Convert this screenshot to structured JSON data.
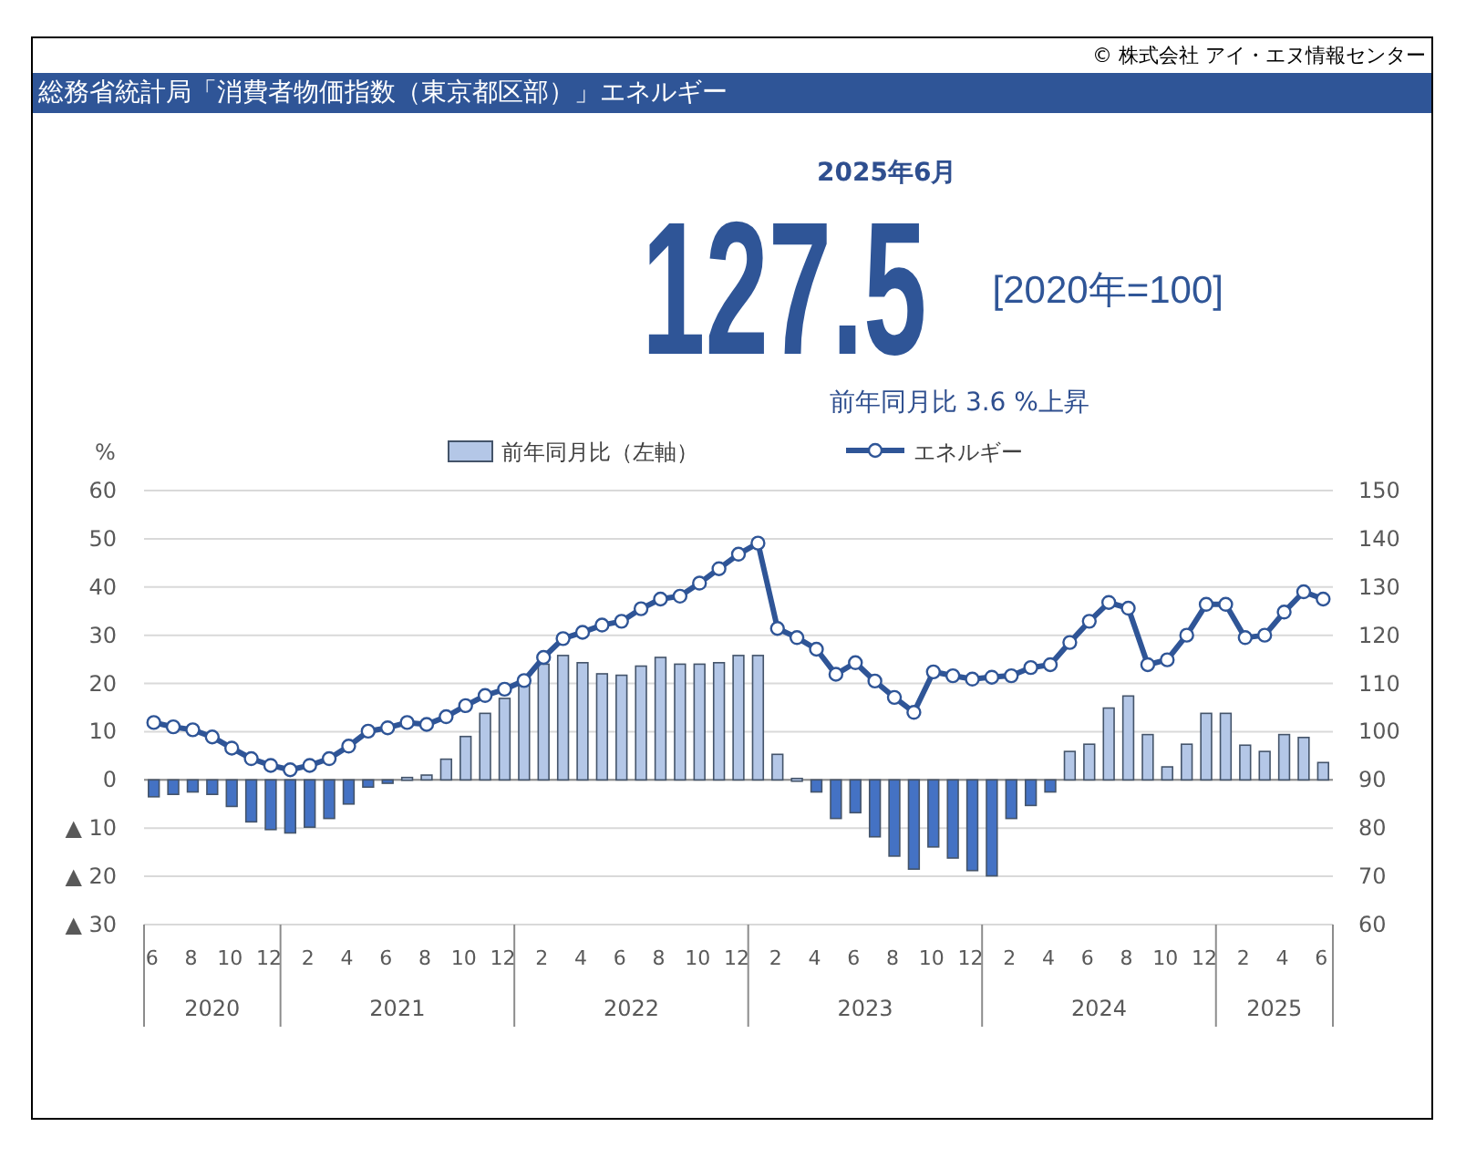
{
  "copyright": "© 株式会社 アイ・エヌ情報センター",
  "title": "総務省統計局「消費者物価指数（東京都区部）」エネルギー",
  "headline": {
    "date": "2025年6月",
    "value": "127.5",
    "base": "[2020年=100]",
    "change": "前年同月比  3.6 %上昇"
  },
  "chart_data": {
    "type": "bar",
    "ylabel": "%",
    "grid": true,
    "legend": true,
    "stacked": true,
    "categories": [
      "6",
      null,
      "8",
      null,
      "10",
      null,
      "12",
      null,
      "2",
      null,
      "4",
      null,
      "6",
      null,
      "8",
      null,
      "10",
      null,
      "12",
      null,
      "2",
      null,
      "4",
      null,
      "6",
      null,
      "8",
      null,
      "10",
      null,
      "12",
      null,
      "2",
      null,
      "4",
      null,
      "6",
      null,
      "8",
      null,
      "10",
      null,
      "12",
      null,
      "2",
      null,
      "4",
      null,
      "6",
      null,
      "8",
      null,
      "10",
      null,
      "12",
      null,
      "2",
      null,
      "4",
      null,
      "6"
    ],
    "annotations": [
      {
        "text": "2020"
      },
      {
        "text": "2021"
      },
      {
        "text": "2022"
      },
      {
        "text": "2023"
      },
      {
        "text": "2024"
      },
      {
        "text": "2025"
      }
    ],
    "series": [
      {
        "name": "前年同月比（左軸）",
        "color": "#b4c7e7",
        "values": [
          null,
          null,
          null,
          null,
          null,
          null,
          null,
          null,
          null,
          null,
          null,
          null,
          null,
          0.5,
          1,
          4.3,
          9,
          13.8,
          16.9,
          20.2,
          24,
          25.8,
          24.3,
          22,
          21.7,
          23.6,
          25.4,
          24,
          24,
          24.3,
          25.8,
          25.8,
          5.3,
          0.3,
          null,
          null,
          null,
          null,
          null,
          null,
          null,
          null,
          null,
          null,
          null,
          null,
          null,
          5.9,
          7.4,
          14.9,
          17.4,
          9.4,
          2.7,
          7.4,
          13.8,
          13.8,
          7.2,
          5.9,
          9.4,
          8.8,
          3.6
        ]
      },
      {
        "color": "#4472c4",
        "values": [
          -3.5,
          -3,
          -2.5,
          -3,
          -5.5,
          -8.7,
          -10.3,
          -11,
          -9.8,
          -8,
          -5,
          -1.5,
          -0.7,
          null,
          null,
          null,
          null,
          null,
          null,
          null,
          null,
          null,
          null,
          null,
          null,
          null,
          null,
          null,
          null,
          null,
          null,
          null,
          null,
          null,
          -2.5,
          -8,
          -6.8,
          -11.8,
          -15.8,
          -18.5,
          -13.9,
          -16.2,
          -18.8,
          -19.9,
          -8,
          -5.3,
          -2.5,
          null,
          null,
          null,
          null,
          null,
          null,
          null,
          null,
          null,
          null,
          null,
          null,
          null,
          null
        ]
      },
      {
        "name": "エネルギー",
        "color": "#2f5597",
        "type": "line",
        "axis": "y2",
        "marker": "circle",
        "values": [
          101.9,
          101,
          100.4,
          98.9,
          96.6,
          94.4,
          93,
          92.1,
          93,
          94.4,
          97,
          100.1,
          100.8,
          101.9,
          101.5,
          103.1,
          105.4,
          107.5,
          108.8,
          110.6,
          115.4,
          119.3,
          120.6,
          122.1,
          122.9,
          125.5,
          127.5,
          128.1,
          130.8,
          133.8,
          136.8,
          139.1,
          121.4,
          119.5,
          117.1,
          111.9,
          114.3,
          110.5,
          107.1,
          104,
          112.4,
          111.6,
          110.9,
          111.3,
          111.6,
          113.3,
          113.9,
          118.5,
          122.9,
          126.8,
          125.6,
          113.9,
          114.9,
          120,
          126.4,
          126.4,
          119.5,
          120,
          124.8,
          129,
          127.5
        ]
      }
    ],
    "ylim": [
      -30,
      60
    ],
    "yticks": [
      60,
      50,
      40,
      30,
      20,
      10,
      0,
      {
        "value": -10,
        "label": "▲ 10"
      },
      {
        "value": -20,
        "label": "▲ 20"
      },
      {
        "value": -30,
        "label": "▲ 30"
      }
    ],
    "y2lim": [
      60,
      150
    ],
    "y2ticks": [
      150,
      140,
      130,
      120,
      110,
      100,
      90,
      80,
      70,
      60
    ]
  }
}
